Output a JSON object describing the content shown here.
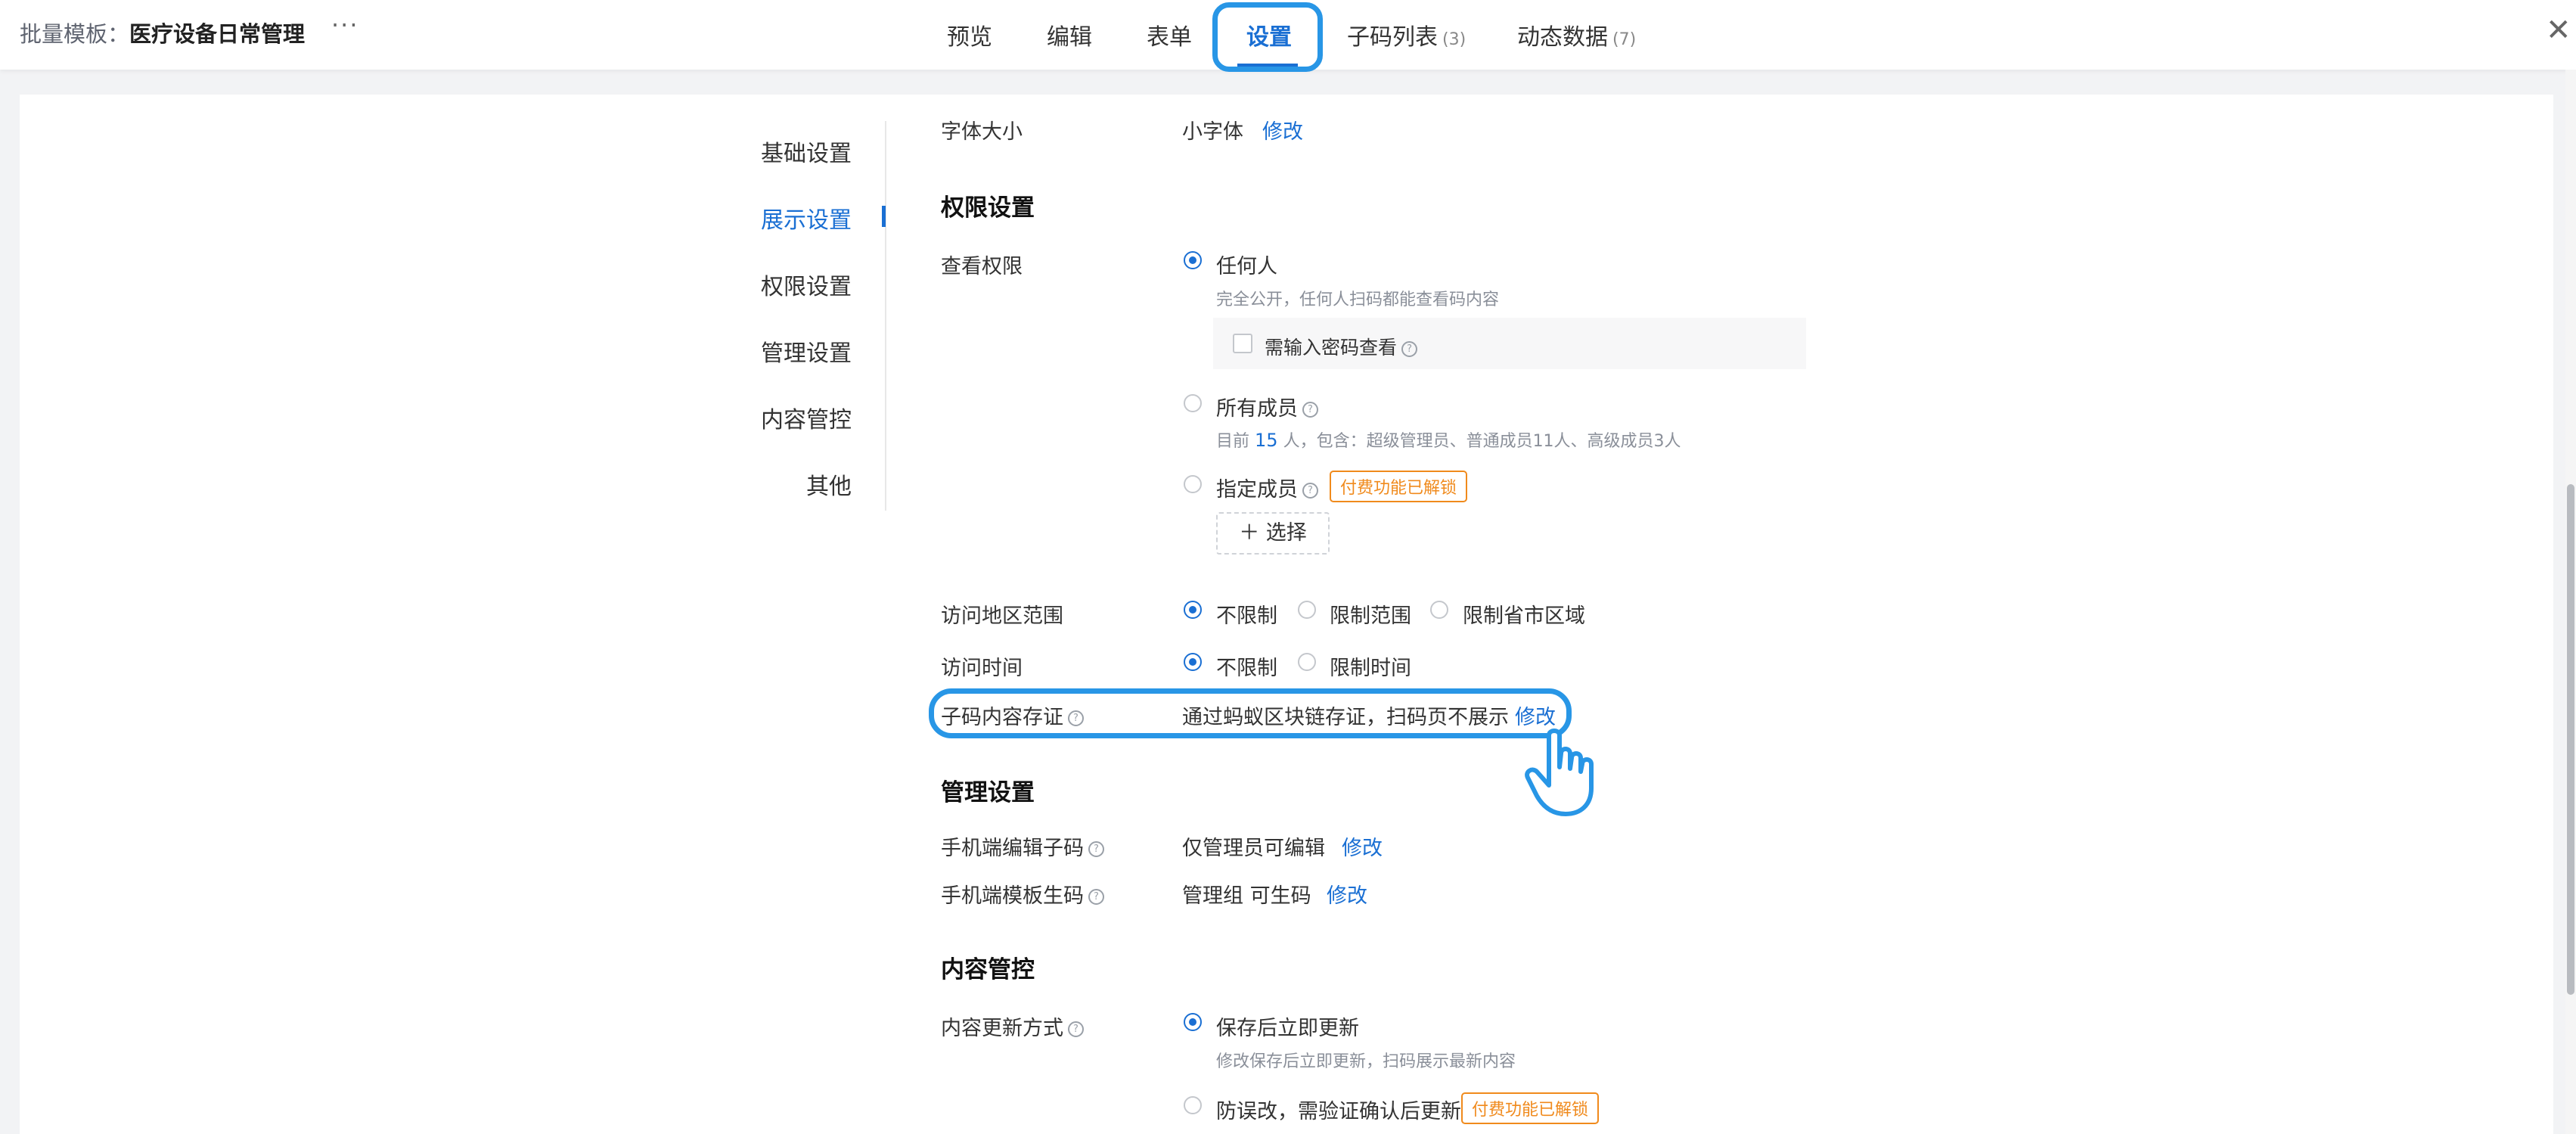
{
  "header": {
    "title_prefix": "批量模板：",
    "title_name": "医疗设备日常管理",
    "more_icon": "ellipsis-icon",
    "tabs": [
      {
        "label": "预览"
      },
      {
        "label": "编辑"
      },
      {
        "label": "表单"
      },
      {
        "label": "设置",
        "active": true
      },
      {
        "label": "子码列表",
        "count": "(3)"
      },
      {
        "label": "动态数据",
        "count": "(7)"
      }
    ],
    "close_icon": "close-icon",
    "accent_color": "#1a6fd3",
    "highlight_color": "#2896e6"
  },
  "nav": {
    "items": [
      "基础设置",
      "展示设置",
      "权限设置",
      "管理设置",
      "内容管控",
      "其他"
    ],
    "active": "展示设置"
  },
  "display": {
    "font_size_label": "字体大小",
    "font_size_value": "小字体",
    "font_size_action": "修改"
  },
  "permission": {
    "section_title": "权限设置",
    "view_label": "查看权限",
    "opt_anyone": "任何人",
    "opt_anyone_desc": "完全公开，任何人扫码都能查看码内容",
    "password_checkbox": "需输入密码查看",
    "opt_all_members": "所有成员",
    "members_desc_prefix": "目前",
    "members_count": "15",
    "members_desc_suffix": "人，包含：超级管理员、普通成员11人、高级成员3人",
    "opt_specified": "指定成员",
    "paid_badge": "付费功能已解锁",
    "select_button": "选择",
    "region_label": "访问地区范围",
    "region_options": [
      "不限制",
      "限制范围",
      "限制省市区域"
    ],
    "time_label": "访问时间",
    "time_options": [
      "不限制",
      "限制时间"
    ],
    "evidence_label": "子码内容存证",
    "evidence_value": "通过蚂蚁区块链存证，扫码页不展示",
    "evidence_action": "修改"
  },
  "management": {
    "section_title": "管理设置",
    "mobile_edit_label": "手机端编辑子码",
    "mobile_edit_value": "仅管理员可编辑",
    "mobile_edit_action": "修改",
    "mobile_generate_label": "手机端模板生码",
    "mobile_generate_value": "管理组 可生码",
    "mobile_generate_action": "修改"
  },
  "content_control": {
    "section_title": "内容管控",
    "update_label": "内容更新方式",
    "opt_immediate": "保存后立即更新",
    "opt_immediate_desc": "修改保存后立即更新，扫码展示最新内容",
    "opt_confirm": "防误改，需验证确认后更新",
    "paid_badge": "付费功能已解锁"
  },
  "icons": {
    "plus": "plus-icon",
    "help": "help-circle-icon",
    "cursor": "hand-pointer-icon"
  }
}
